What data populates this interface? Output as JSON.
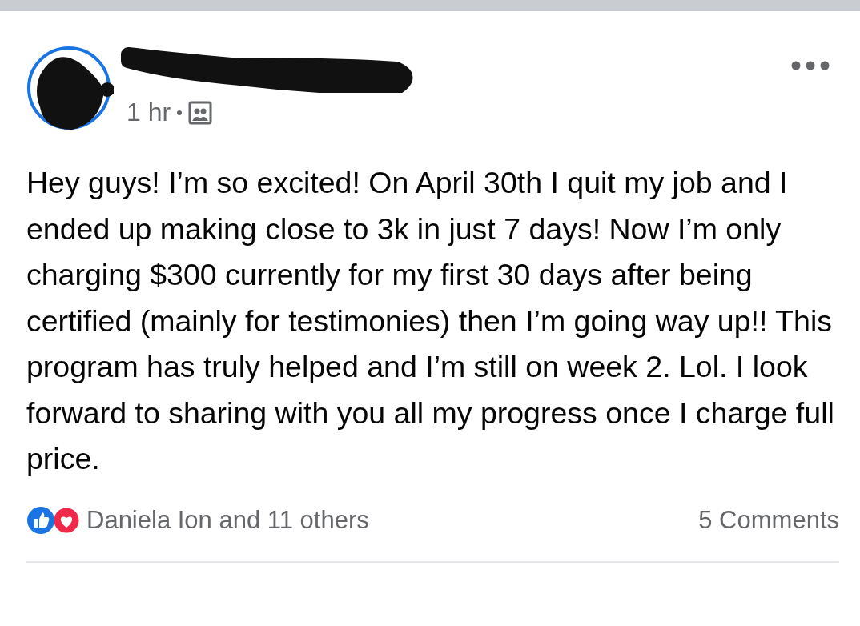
{
  "post": {
    "time": "1 hr",
    "text": "Hey guys! I’m so excited! On April 30th I quit my job and I ended up making close to 3k in just 7 days! Now I’m only charging $300 currently for my first 30 days after being certified (mainly for testimonies) then I’m going way up!! This program has truly helped and I’m still on week 2. Lol. I look forward to sharing with you all my progress once I charge full price.",
    "reactions": "Daniela Ion and 11 others",
    "comments": "5 Comments"
  }
}
